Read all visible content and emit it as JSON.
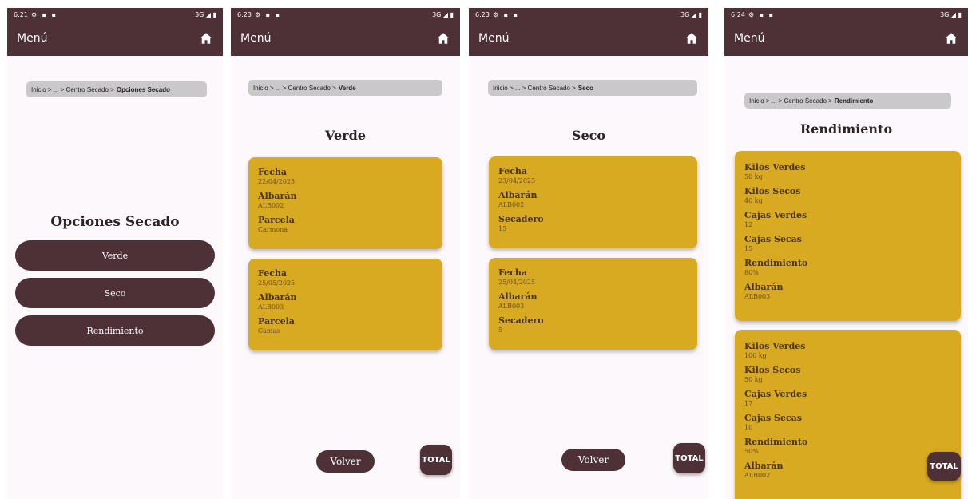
{
  "screens": [
    {
      "status": {
        "time": "6:21",
        "network": "3G"
      },
      "appbar": {
        "menu_label": "Menú"
      },
      "breadcrumb": {
        "prefix": "Inicio > ... > Centro Secado >",
        "current": "Opciones Secado"
      },
      "title": "Opciones Secado",
      "buttons": [
        "Verde",
        "Seco",
        "Rendimiento"
      ]
    },
    {
      "status": {
        "time": "6:23",
        "network": "3G"
      },
      "appbar": {
        "menu_label": "Menú"
      },
      "breadcrumb": {
        "prefix": "Inicio > ... > Centro Secado >",
        "current": "Verde"
      },
      "title": "Verde",
      "cards": [
        {
          "fields": [
            {
              "label": "Fecha",
              "value": "22/04/2025"
            },
            {
              "label": "Albarán",
              "value": "ALB002"
            },
            {
              "label": "Parcela",
              "value": "Carmona"
            }
          ]
        },
        {
          "fields": [
            {
              "label": "Fecha",
              "value": "25/05/2025"
            },
            {
              "label": "Albarán",
              "value": "ALB003"
            },
            {
              "label": "Parcela",
              "value": "Camas"
            }
          ]
        }
      ],
      "volver_label": "Volver",
      "total_label": "TOTAL"
    },
    {
      "status": {
        "time": "6:23",
        "network": "3G"
      },
      "appbar": {
        "menu_label": "Menú"
      },
      "breadcrumb": {
        "prefix": "Inicio > ... > Centro Secado >",
        "current": "Seco"
      },
      "title": "Seco",
      "cards": [
        {
          "fields": [
            {
              "label": "Fecha",
              "value": "23/04/2025"
            },
            {
              "label": "Albarán",
              "value": "ALB002"
            },
            {
              "label": "Secadero",
              "value": "15"
            }
          ]
        },
        {
          "fields": [
            {
              "label": "Fecha",
              "value": "25/04/2025"
            },
            {
              "label": "Albarán",
              "value": "ALB003"
            },
            {
              "label": "Secadero",
              "value": "5"
            }
          ]
        }
      ],
      "volver_label": "Volver",
      "total_label": "TOTAL"
    },
    {
      "status": {
        "time": "6:24",
        "network": "3G"
      },
      "appbar": {
        "menu_label": "Menú"
      },
      "breadcrumb": {
        "prefix": "Inicio > ... > Centro Secado >",
        "current": "Rendimiento"
      },
      "title": "Rendimiento",
      "cards": [
        {
          "fields": [
            {
              "label": "Kilos Verdes",
              "value": "50 kg"
            },
            {
              "label": "Kilos Secos",
              "value": "40 kg"
            },
            {
              "label": "Cajas Verdes",
              "value": "12"
            },
            {
              "label": "Cajas Secas",
              "value": "15"
            },
            {
              "label": "Rendimiento",
              "value": "80%"
            },
            {
              "label": "Albarán",
              "value": "ALB003"
            }
          ]
        },
        {
          "fields": [
            {
              "label": "Kilos Verdes",
              "value": "100 kg"
            },
            {
              "label": "Kilos Secos",
              "value": "50 kg"
            },
            {
              "label": "Cajas Verdes",
              "value": "17"
            },
            {
              "label": "Cajas Secas",
              "value": "10"
            },
            {
              "label": "Rendimiento",
              "value": "50%"
            },
            {
              "label": "Albarán",
              "value": "ALB002"
            }
          ]
        }
      ],
      "total_label": "TOTAL"
    }
  ],
  "icons": {
    "home": "home-icon",
    "signal": "signal-icon",
    "battery": "battery-icon"
  },
  "colors": {
    "primary": "#4e3136",
    "card": "#d8aa22",
    "background": "#fdf8fb",
    "breadcrumb": "#cbc8c9"
  }
}
